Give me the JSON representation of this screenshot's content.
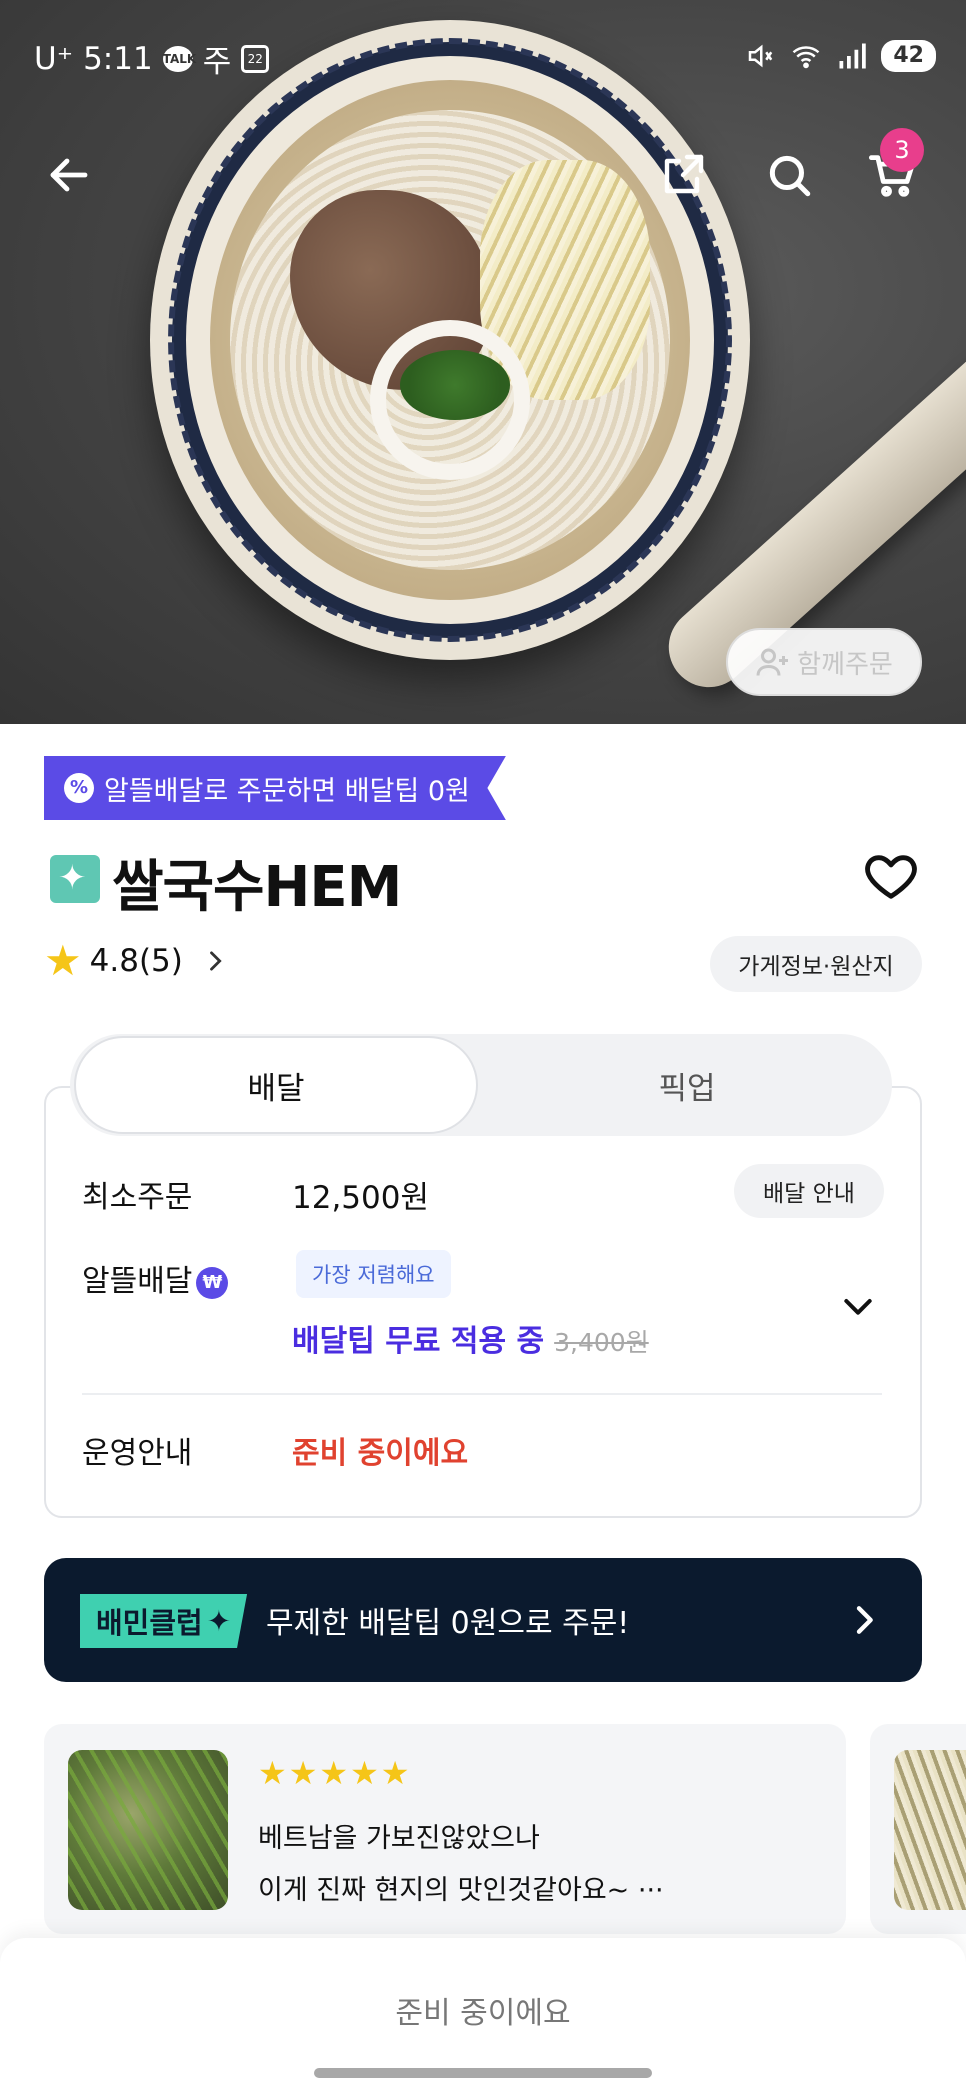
{
  "status_bar": {
    "carrier": "U⁺",
    "time": "5:11",
    "talk_label": "TALK",
    "notif_text": "주",
    "calendar_day": "22",
    "battery": "42"
  },
  "nav": {
    "back_icon": "arrow-left-icon",
    "share_icon": "share-icon",
    "search_icon": "search-icon",
    "cart_icon": "cart-icon",
    "cart_count": "3"
  },
  "hero": {
    "together_button_label": "함께주문"
  },
  "promo_ribbon": {
    "text": "알뜰배달로 주문하면 배달팁 0원",
    "badge_symbol": "%"
  },
  "store": {
    "name": "쌀국수HEM",
    "rating": "4.8(5)",
    "info_button": "가게정보·원산지"
  },
  "tabs": {
    "delivery": "배달",
    "pickup": "픽업"
  },
  "delivery_info": {
    "min_order_label": "최소주문",
    "min_order_value": "12,500원",
    "guide_button": "배달 안내",
    "saver_label": "알뜰배달",
    "saver_badge": "₩",
    "cheapest_tag": "가장 저렴해요",
    "free_tip_text": "배달팁 무료 적용 중",
    "original_tip": "3,400원",
    "operation_label": "운영안내",
    "operation_status": "준비 중이에요"
  },
  "club_banner": {
    "tag": "배민클럽",
    "text": "무제한 배달팁 0원으로 주문!"
  },
  "review": {
    "stars": "★★★★★",
    "line1": "베트남을 가보진않았으나",
    "line2": "이게 진짜 현지의 맛인것같아요~ ···"
  },
  "bottom_bar": {
    "text": "준비 중이에요"
  },
  "colors": {
    "primary_purple": "#5b4be6",
    "tip_blue": "#4a2de0",
    "status_red": "#e0422f",
    "club_navy": "#0b1a2e",
    "club_mint": "#3fd0b0",
    "cart_badge_pink": "#e83e8c",
    "star_yellow": "#f5c518"
  }
}
